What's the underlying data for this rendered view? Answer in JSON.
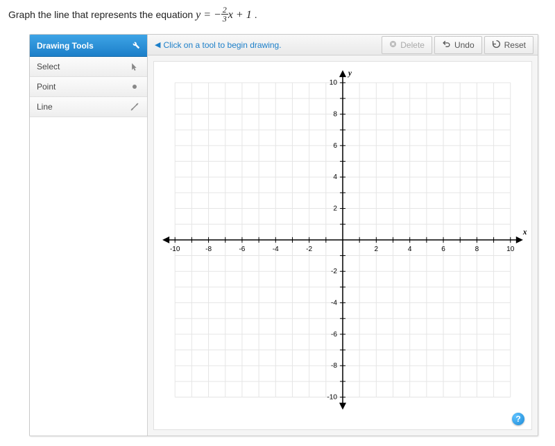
{
  "prompt": {
    "leadText": "Graph the line that represents the equation ",
    "eq_lhs": "y",
    "eq_eq": "=",
    "eq_neg": "−",
    "eq_num": "2",
    "eq_den": "3",
    "eq_var": "x",
    "eq_plus": " + 1",
    "period": "."
  },
  "sidebar": {
    "header": "Drawing Tools",
    "tools": [
      {
        "label": "Select",
        "icon": "cursor"
      },
      {
        "label": "Point",
        "icon": "point"
      },
      {
        "label": "Line",
        "icon": "line"
      }
    ]
  },
  "toolbar": {
    "hint": "Click on a tool to begin drawing.",
    "delete": "Delete",
    "undo": "Undo",
    "reset": "Reset"
  },
  "help": "?",
  "chart_data": {
    "type": "scatter",
    "title": "",
    "xlabel": "x",
    "ylabel": "y",
    "xlim": [
      -10,
      10
    ],
    "ylim": [
      -10,
      10
    ],
    "xticks": [
      -10,
      -8,
      -6,
      -4,
      -2,
      2,
      4,
      6,
      8,
      10
    ],
    "yticks": [
      -10,
      -8,
      -6,
      -4,
      -2,
      2,
      4,
      6,
      8,
      10
    ],
    "grid": true,
    "series": []
  }
}
